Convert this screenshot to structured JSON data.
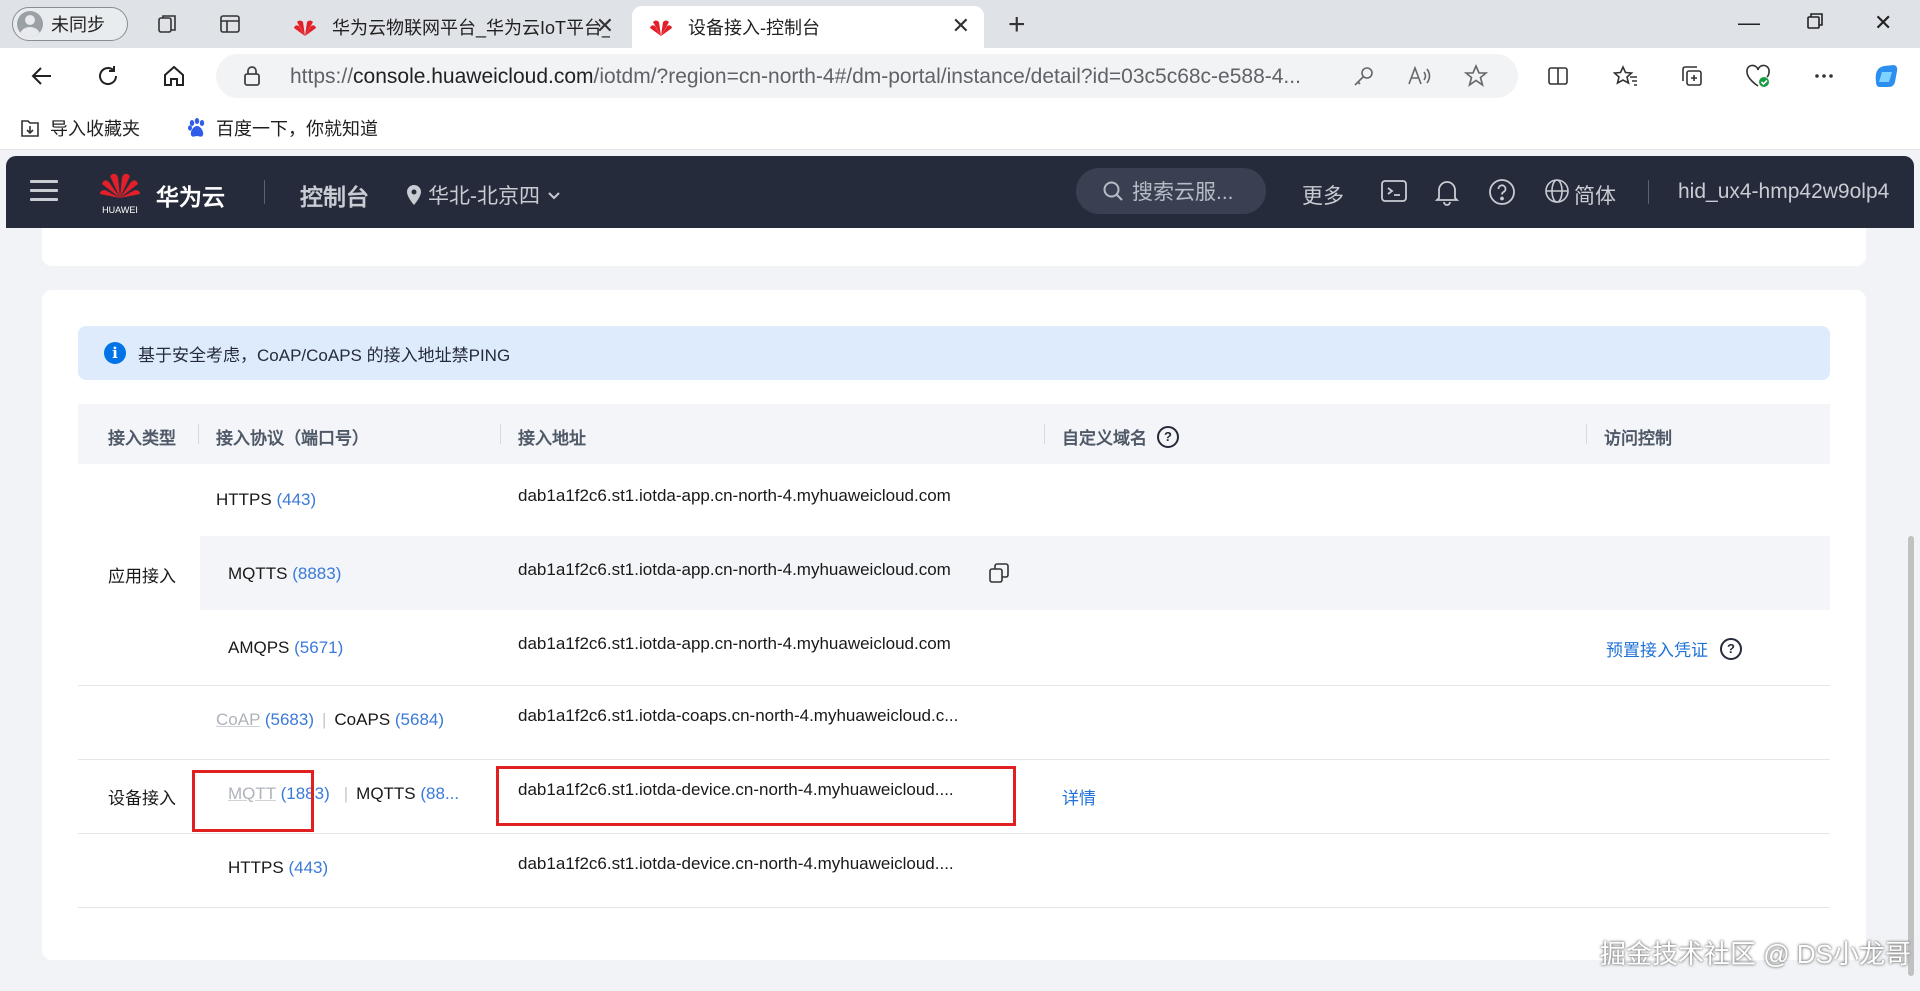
{
  "browser": {
    "profile_label": "未同步",
    "tabs": [
      {
        "title": "华为云物联网平台_华为云IoT平台_物联网云平台",
        "active": false
      },
      {
        "title": "设备接入-控制台",
        "active": true
      }
    ],
    "url_prefix": "https://",
    "url_host": "console.huaweicloud.com",
    "url_path": "/iotdm/?region=cn-north-4#/dm-portal/instance/detail?id=03c5c68c-e588-4...",
    "bookmarks": [
      "导入收藏夹",
      "百度一下，你就知道"
    ]
  },
  "console": {
    "brand": "华为云",
    "logo_text": "HUAWEI",
    "title": "控制台",
    "region": "华北-北京四",
    "search_placeholder": "搜索云服...",
    "more": "更多",
    "language": "简体",
    "username": "hid_ux4-hmp42w9olp4"
  },
  "alert": {
    "text": "基于安全考虑，CoAP/CoAPS 的接入地址禁PING"
  },
  "table": {
    "headers": {
      "type": "接入类型",
      "protocol": "接入协议（端口号）",
      "address": "接入地址",
      "domain": "自定义域名",
      "access": "访问控制"
    },
    "app_group": {
      "label": "应用接入",
      "rows": [
        {
          "protocol": "HTTPS",
          "port": "(443)",
          "address": "dab1a1f2c6.st1.iotda-app.cn-north-4.myhuaweicloud.com"
        },
        {
          "protocol": "MQTTS",
          "port": "(8883)",
          "address": "dab1a1f2c6.st1.iotda-app.cn-north-4.myhuaweicloud.com"
        },
        {
          "protocol": "AMQPS",
          "port": "(5671)",
          "address": "dab1a1f2c6.st1.iotda-app.cn-north-4.myhuaweicloud.com",
          "access": "预置接入凭证"
        }
      ]
    },
    "device_group": {
      "label": "设备接入",
      "rows": [
        {
          "protocol": "CoAP",
          "port": "(5683)",
          "protocol2": "CoAPS",
          "port2": "(5684)",
          "address": "dab1a1f2c6.st1.iotda-coaps.cn-north-4.myhuaweicloud.c..."
        },
        {
          "protocol": "MQTT",
          "port": "(1883)",
          "protocol2": "MQTTS",
          "port2": "(88...",
          "address": "dab1a1f2c6.st1.iotda-device.cn-north-4.myhuaweicloud....",
          "domain": "详情"
        },
        {
          "protocol": "HTTPS",
          "port": "(443)",
          "address": "dab1a1f2c6.st1.iotda-device.cn-north-4.myhuaweicloud...."
        }
      ]
    }
  },
  "watermark": "掘金技术社区 @ DS小龙哥",
  "colors": {
    "accent": "#1f72d8",
    "header_bg": "#252b3a",
    "highlight_box": "#e02020",
    "alert_bg": "#deebfd"
  }
}
